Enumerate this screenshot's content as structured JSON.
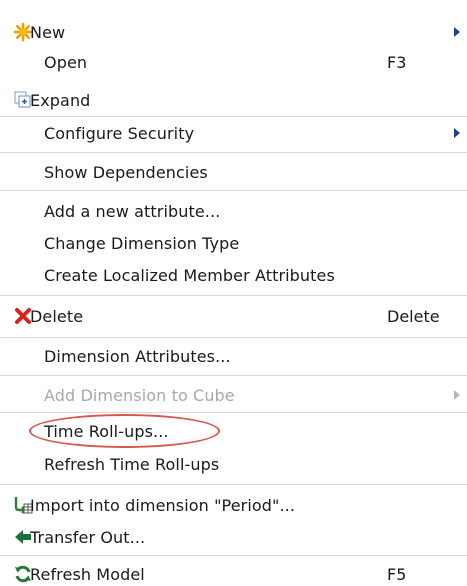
{
  "menu": {
    "items": [
      {
        "label": "New",
        "shortcut": "",
        "submenu": true,
        "disabled": false,
        "icon": "star-icon"
      },
      {
        "label": "Open",
        "shortcut": "F3",
        "submenu": false,
        "disabled": false,
        "icon": ""
      },
      {
        "label": "Expand",
        "shortcut": "",
        "submenu": false,
        "disabled": false,
        "icon": "expand-icon"
      },
      {
        "label": "Configure Security",
        "shortcut": "",
        "submenu": true,
        "disabled": false,
        "icon": ""
      },
      {
        "label": "Show Dependencies",
        "shortcut": "",
        "submenu": false,
        "disabled": false,
        "icon": ""
      },
      {
        "label": "Add a new attribute...",
        "shortcut": "",
        "submenu": false,
        "disabled": false,
        "icon": ""
      },
      {
        "label": "Change Dimension Type",
        "shortcut": "",
        "submenu": false,
        "disabled": false,
        "icon": ""
      },
      {
        "label": "Create Localized Member Attributes",
        "shortcut": "",
        "submenu": false,
        "disabled": false,
        "icon": ""
      },
      {
        "label": "Delete",
        "shortcut": "Delete",
        "submenu": false,
        "disabled": false,
        "icon": "delete-icon"
      },
      {
        "label": "Dimension Attributes...",
        "shortcut": "",
        "submenu": false,
        "disabled": false,
        "icon": ""
      },
      {
        "label": "Add Dimension to Cube",
        "shortcut": "",
        "submenu": true,
        "disabled": true,
        "icon": ""
      },
      {
        "label": "Time Roll-ups...",
        "shortcut": "",
        "submenu": false,
        "disabled": false,
        "icon": "",
        "highlighted": true
      },
      {
        "label": "Refresh Time Roll-ups",
        "shortcut": "",
        "submenu": false,
        "disabled": false,
        "icon": ""
      },
      {
        "label": "Import into dimension \"Period\"...",
        "shortcut": "",
        "submenu": false,
        "disabled": false,
        "icon": "import-icon"
      },
      {
        "label": "Transfer Out...",
        "shortcut": "",
        "submenu": false,
        "disabled": false,
        "icon": "transfer-out-icon"
      },
      {
        "label": "Refresh Model",
        "shortcut": "F5",
        "submenu": false,
        "disabled": false,
        "icon": "refresh-icon"
      }
    ]
  },
  "colors": {
    "text": "#1a1a1a",
    "disabled_text": "#a8a8a8",
    "separator": "#d9d9d9",
    "submenu_arrow": "#1f3e99",
    "highlight_ring": "#d9584d"
  }
}
